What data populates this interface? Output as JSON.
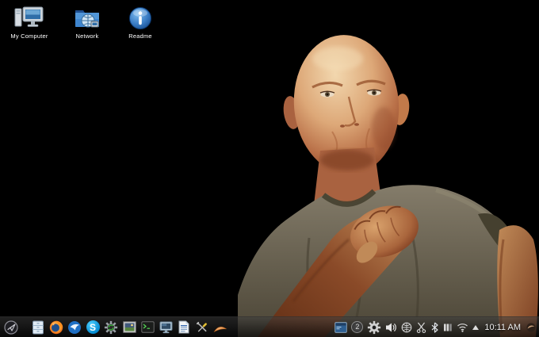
{
  "desktop": {
    "icons": [
      {
        "label": "My Computer",
        "icon": "computer-icon"
      },
      {
        "label": "Network",
        "icon": "network-folder-icon"
      },
      {
        "label": "Readme",
        "icon": "info-icon"
      }
    ],
    "wallpaper_description": "bald man in olive t-shirt with raised fist, black background"
  },
  "taskbar": {
    "launchers": [
      {
        "name": "distro-menu"
      },
      {
        "name": "file-manager"
      },
      {
        "name": "firefox"
      },
      {
        "name": "thunderbird"
      },
      {
        "name": "skype"
      },
      {
        "name": "package-manager"
      },
      {
        "name": "screenshot-viewer"
      },
      {
        "name": "terminal"
      },
      {
        "name": "display-settings"
      },
      {
        "name": "word-processor"
      },
      {
        "name": "system-tools"
      },
      {
        "name": "orange-crescent-app"
      }
    ],
    "glyphs": {
      "skype": "S"
    },
    "tray": {
      "icons": [
        "terminal-window",
        "update-notifier",
        "settings-gear",
        "volume",
        "network-globe",
        "clipboard-scissors",
        "bluetooth",
        "battery-meter",
        "wifi",
        "expand-arrow",
        "corner-crescent"
      ],
      "update_badge": "2",
      "clock": "10:11 AM"
    }
  },
  "colors": {
    "desktop_bg": "#000000",
    "panel_bg": "rgba(20,20,20,0.65)",
    "label_text": "#ffffff",
    "skype_blue": "#00aff0",
    "firefox_orange": "#ff8f1f",
    "crescent_orange": "#ef9e55"
  }
}
